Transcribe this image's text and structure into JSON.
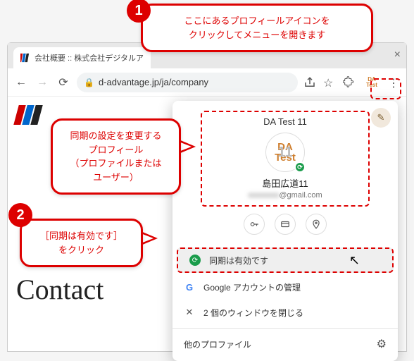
{
  "annotations": {
    "callout1": "ここにあるプロフィールアイコンを\nクリックしてメニューを開きます",
    "callout2": "同期の設定を変更する\nプロフィール\n（プロファイルまたは\nユーザー）",
    "callout3": "［同期は有効です］\nをクリック",
    "badge1": "1",
    "badge2": "2"
  },
  "browser": {
    "tab_title": "会社概要 :: 株式会社デジタルア",
    "url": "d-advantage.jp/ja/company",
    "profile_chip": "DA\nTest"
  },
  "page": {
    "contact_heading": "Contact"
  },
  "profile_menu": {
    "name": "DA Test 11",
    "avatar_text": "DA\nTest",
    "avatar_overlay": "11",
    "user": "島田広道11",
    "email_suffix": "@gmail.com",
    "rows": {
      "sync": "同期は有効です",
      "manage": "Google アカウントの管理",
      "close_windows": "2 個のウィンドウを閉じる"
    },
    "other_profiles": "他のプロファイル"
  }
}
